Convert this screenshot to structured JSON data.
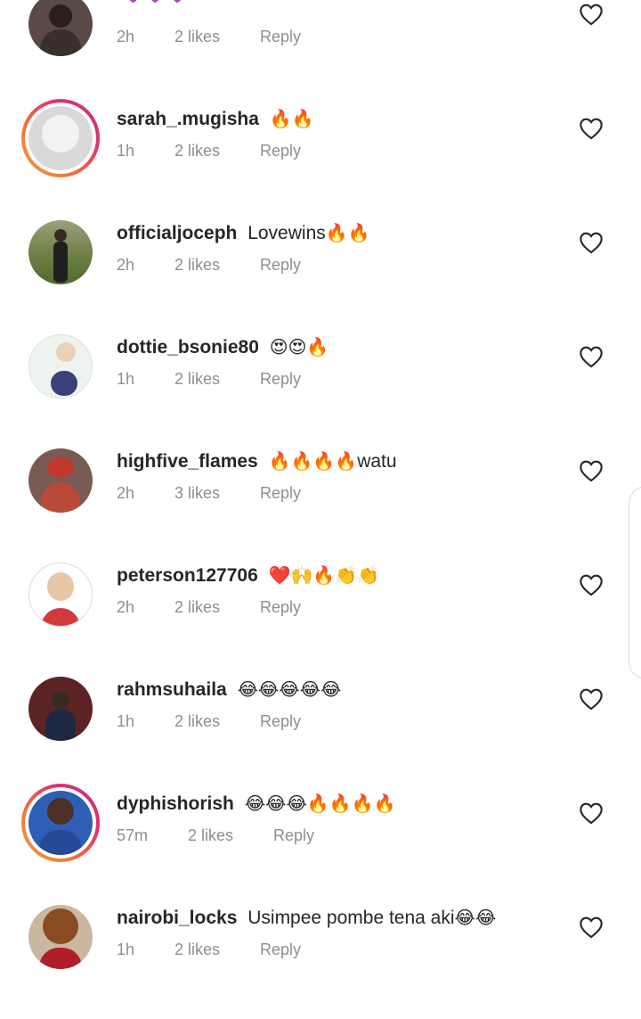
{
  "comments": [
    {
      "username": "",
      "text": "",
      "emoji": "💜💜💜",
      "time": "2h",
      "likes": "2 likes",
      "reply": "Reply"
    },
    {
      "username": "sarah_.mugisha",
      "text": "",
      "emoji": "🔥🔥",
      "time": "1h",
      "likes": "2 likes",
      "reply": "Reply"
    },
    {
      "username": "officialjoceph",
      "text": "Lovewins",
      "emoji": "🔥🔥",
      "time": "2h",
      "likes": "2 likes",
      "reply": "Reply"
    },
    {
      "username": "dottie_bsonie80",
      "text": "",
      "emoji": "😍😍🔥",
      "time": "1h",
      "likes": "2 likes",
      "reply": "Reply"
    },
    {
      "username": "highfive_flames",
      "text": "",
      "emoji": "🔥🔥🔥🔥",
      "text_after": "watu",
      "time": "2h",
      "likes": "3 likes",
      "reply": "Reply"
    },
    {
      "username": "peterson127706",
      "text": "",
      "emoji": "❤️🙌🔥👏👏",
      "time": "2h",
      "likes": "2 likes",
      "reply": "Reply"
    },
    {
      "username": "rahmsuhaila",
      "text": "",
      "emoji": "😂😂😂😂😂",
      "time": "1h",
      "likes": "2 likes",
      "reply": "Reply"
    },
    {
      "username": "dyphishorish",
      "text": "",
      "emoji": "😂😂😂🔥🔥🔥🔥",
      "time": "57m",
      "likes": "2 likes",
      "reply": "Reply"
    },
    {
      "username": "nairobi_locks",
      "text": "Usimpee pombe tena aki",
      "emoji": "😂😂",
      "time": "1h",
      "likes": "2 likes",
      "reply": "Reply"
    }
  ],
  "icons": {
    "like": "heart-outline-icon"
  },
  "colors": {
    "meta": "#8e8e8e",
    "story_ring_start": "#f9a23d",
    "story_ring_end": "#c13584"
  }
}
